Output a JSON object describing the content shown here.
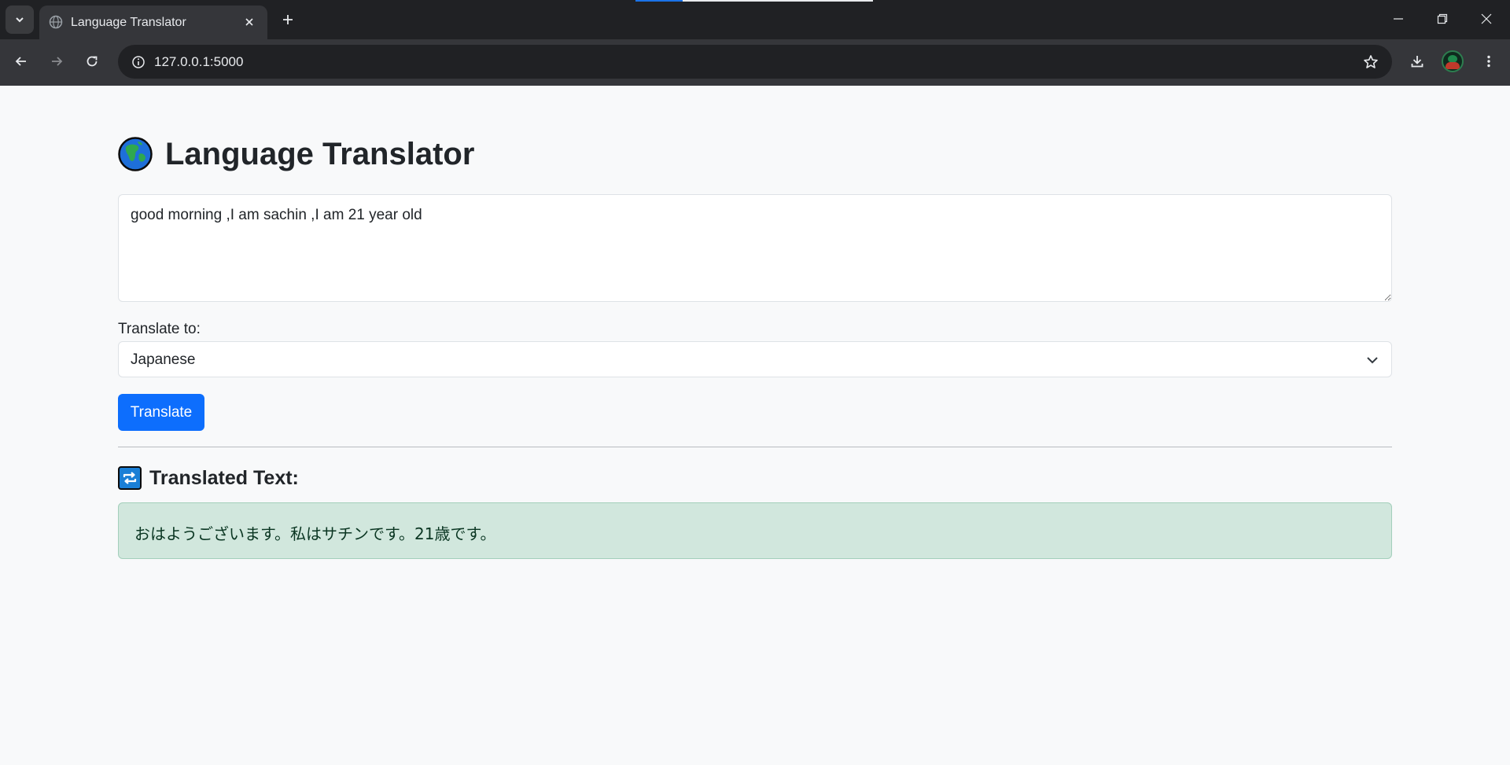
{
  "browser": {
    "tab_title": "Language Translator",
    "url": "127.0.0.1:5000",
    "theme": {
      "tabbar_bg": "#202124",
      "toolbar_bg": "#35363a",
      "omnibox_bg": "#202124",
      "text": "#e8eaed"
    }
  },
  "page": {
    "title": "Language Translator",
    "title_icon": "globe-icon",
    "input_text": "good morning ,I am sachin ,I am 21 year old",
    "target_label": "Translate to:",
    "target_language": "Japanese",
    "translate_button": "Translate",
    "result_heading": "Translated Text:",
    "result_icon": "repeat-icon",
    "result_text": "おはようございます。私はサチンです。21歳です。",
    "colors": {
      "primary": "#0d6efd",
      "success_bg": "#d1e7dd",
      "success_text": "#0a3622",
      "page_bg": "#f8f9fa"
    }
  }
}
